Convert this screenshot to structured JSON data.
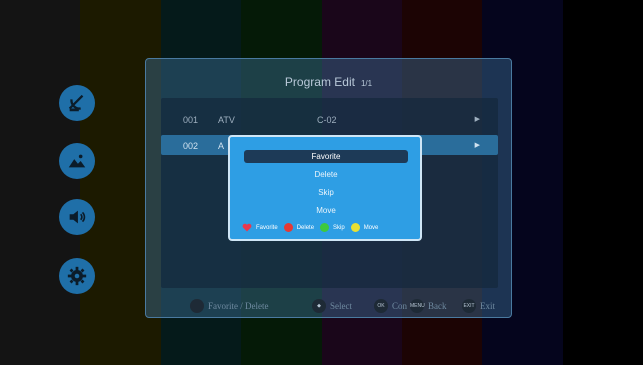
{
  "background_bar_colors": [
    "#2e2e2e",
    "#3f3a00",
    "#0d3b3b",
    "#0c3a10",
    "#3a0f3a",
    "#3e0a0a",
    "#0d0d40",
    "#000000"
  ],
  "side_menu": {
    "items": [
      {
        "icon": "satellite-dish-icon"
      },
      {
        "icon": "picture-icon"
      },
      {
        "icon": "speaker-icon"
      },
      {
        "icon": "gear-icon"
      }
    ]
  },
  "panel": {
    "title": "Program Edit",
    "page": "1/1"
  },
  "programs": [
    {
      "num": "001",
      "type": "ATV",
      "name": "C-02",
      "arrow": "▶"
    },
    {
      "num": "002",
      "type": "A",
      "name": "",
      "arrow": "▶"
    }
  ],
  "help_bar": {
    "favorite_delete": "Favorite / Delete",
    "select": "Select",
    "ok_key": "OK",
    "confirm": "Con",
    "menu_key": "MENU",
    "back": "Back",
    "exit_key": "EXIT",
    "exit": "Exit"
  },
  "dialog": {
    "options": [
      "Favorite",
      "Delete",
      "Skip",
      "Move"
    ],
    "legend": [
      {
        "label": "Favorite",
        "color": "#e8384f",
        "shape": "heart"
      },
      {
        "label": "Delete",
        "color": "#e53935",
        "shape": "dot"
      },
      {
        "label": "Skip",
        "color": "#3ec93e",
        "shape": "dot"
      },
      {
        "label": "Move",
        "color": "#e8e034",
        "shape": "dot"
      }
    ]
  },
  "colors": {
    "accent": "#2e9ee4",
    "selected_row": "#2a6d9b",
    "dialog_active": "#1d3a57"
  }
}
